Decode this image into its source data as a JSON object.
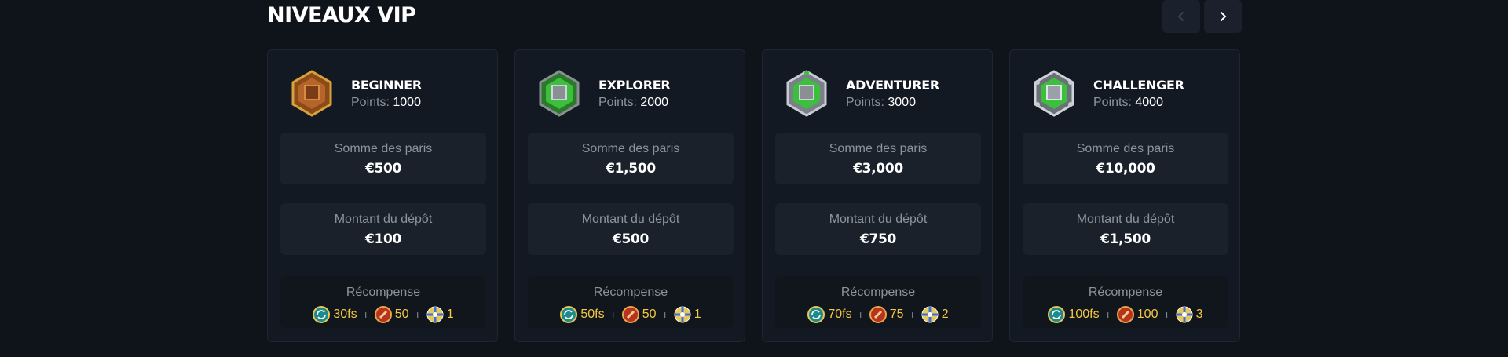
{
  "section": {
    "title": "NIVEAUX VIP"
  },
  "nav": {
    "prev_icon": "chevron-left-icon",
    "next_icon": "chevron-right-icon"
  },
  "colors": {
    "background": "#0f141b",
    "card": "#131922",
    "reward_text": "#f5c842",
    "muted": "#8b949e"
  },
  "labels": {
    "points": "Points:",
    "bets_total": "Somme des paris",
    "deposit_amount": "Montant du dépôt",
    "reward": "Récompense"
  },
  "levels": [
    {
      "name": "BEGINNER",
      "points": "1000",
      "bets": "€500",
      "deposit": "€100",
      "reward": {
        "freespins": "30fs",
        "second": "50",
        "third": "1"
      },
      "badge": "bronze-badge-icon"
    },
    {
      "name": "EXPLORER",
      "points": "2000",
      "bets": "€1,500",
      "deposit": "€500",
      "reward": {
        "freespins": "50fs",
        "second": "50",
        "third": "1"
      },
      "badge": "green-badge-icon"
    },
    {
      "name": "ADVENTURER",
      "points": "3000",
      "bets": "€3,000",
      "deposit": "€750",
      "reward": {
        "freespins": "70fs",
        "second": "75",
        "third": "2"
      },
      "badge": "green-silver-badge-icon"
    },
    {
      "name": "CHALLENGER",
      "points": "4000",
      "bets": "€10,000",
      "deposit": "€1,500",
      "reward": {
        "freespins": "100fs",
        "second": "100",
        "third": "3"
      },
      "badge": "silver-badge-icon"
    }
  ]
}
